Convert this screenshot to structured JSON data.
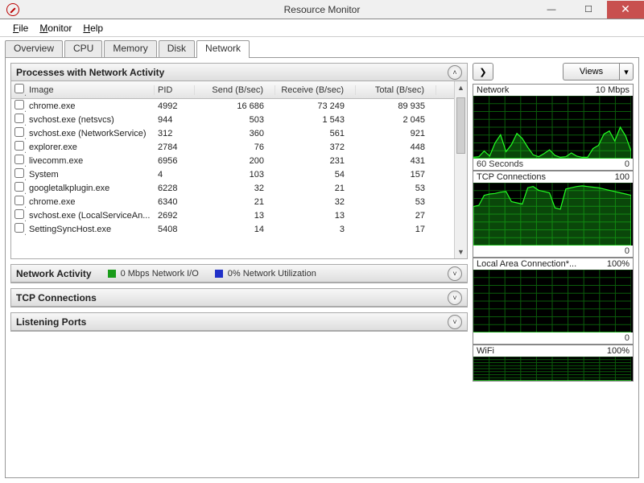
{
  "window": {
    "title": "Resource Monitor"
  },
  "menus": [
    "File",
    "Monitor",
    "Help"
  ],
  "tabs": [
    "Overview",
    "CPU",
    "Memory",
    "Disk",
    "Network"
  ],
  "active_tab": 4,
  "processes_panel": {
    "title": "Processes with Network Activity",
    "columns": [
      "Image",
      "PID",
      "Send (B/sec)",
      "Receive (B/sec)",
      "Total (B/sec)"
    ],
    "rows": [
      {
        "image": "chrome.exe",
        "pid": "4992",
        "send": "16 686",
        "recv": "73 249",
        "total": "89 935"
      },
      {
        "image": "svchost.exe (netsvcs)",
        "pid": "944",
        "send": "503",
        "recv": "1 543",
        "total": "2 045"
      },
      {
        "image": "svchost.exe (NetworkService)",
        "pid": "312",
        "send": "360",
        "recv": "561",
        "total": "921"
      },
      {
        "image": "explorer.exe",
        "pid": "2784",
        "send": "76",
        "recv": "372",
        "total": "448"
      },
      {
        "image": "livecomm.exe",
        "pid": "6956",
        "send": "200",
        "recv": "231",
        "total": "431"
      },
      {
        "image": "System",
        "pid": "4",
        "send": "103",
        "recv": "54",
        "total": "157"
      },
      {
        "image": "googletalkplugin.exe",
        "pid": "6228",
        "send": "32",
        "recv": "21",
        "total": "53"
      },
      {
        "image": "chrome.exe",
        "pid": "6340",
        "send": "21",
        "recv": "32",
        "total": "53"
      },
      {
        "image": "svchost.exe (LocalServiceAn...",
        "pid": "2692",
        "send": "13",
        "recv": "13",
        "total": "27"
      },
      {
        "image": "SettingSyncHost.exe",
        "pid": "5408",
        "send": "14",
        "recv": "3",
        "total": "17"
      }
    ]
  },
  "network_activity_panel": {
    "title": "Network Activity",
    "legend_io_color": "#1a9c1a",
    "legend_io": "0 Mbps Network I/O",
    "legend_util_color": "#2030c8",
    "legend_util": "0% Network Utilization"
  },
  "tcp_panel": {
    "title": "TCP Connections"
  },
  "listening_panel": {
    "title": "Listening Ports"
  },
  "right": {
    "views_label": "Views",
    "graphs": [
      {
        "title": "Network",
        "scale": "10 Mbps",
        "foot_left": "60 Seconds",
        "foot_right": "0",
        "variant": "spiky"
      },
      {
        "title": "TCP Connections",
        "scale": "100",
        "foot_right": "0",
        "variant": "high"
      },
      {
        "title": "Local Area Connection*...",
        "scale": "100%",
        "foot_right": "0",
        "variant": "flat"
      },
      {
        "title": "WiFi",
        "scale": "100%",
        "variant": "flat",
        "short": true
      }
    ]
  },
  "chart_data": [
    {
      "type": "area",
      "title": "Network",
      "ylabel": "Mbps",
      "xlabel": "Seconds",
      "ylim": [
        0,
        10
      ],
      "x_seconds": 60,
      "values": [
        0.2,
        0.3,
        1.2,
        0.4,
        2.5,
        3.8,
        1.1,
        2.2,
        4.0,
        3.2,
        1.8,
        0.6,
        0.3,
        0.8,
        1.4,
        0.5,
        0.2,
        0.3,
        0.9,
        0.4,
        0.2,
        0.2,
        1.6,
        2.1,
        3.9,
        4.4,
        2.8,
        5.0,
        3.6,
        1.2
      ]
    },
    {
      "type": "area",
      "title": "TCP Connections",
      "ylim": [
        0,
        100
      ],
      "x_seconds": 60,
      "values": [
        62,
        64,
        80,
        82,
        83,
        85,
        86,
        70,
        68,
        66,
        92,
        94,
        88,
        86,
        84,
        60,
        58,
        90,
        92,
        94,
        95,
        94,
        93,
        92,
        90,
        88,
        86,
        84,
        82,
        80
      ]
    },
    {
      "type": "area",
      "title": "Local Area Connection*",
      "ylim": [
        0,
        100
      ],
      "unit": "%",
      "x_seconds": 60,
      "values": [
        0,
        0,
        0,
        0,
        0,
        0,
        0,
        0,
        0,
        0,
        0,
        0,
        0,
        0,
        0,
        0,
        0,
        0,
        0,
        0,
        0,
        0,
        0,
        0,
        0,
        0,
        0,
        0,
        0,
        0
      ]
    },
    {
      "type": "area",
      "title": "WiFi",
      "ylim": [
        0,
        100
      ],
      "unit": "%",
      "x_seconds": 60,
      "values": [
        0,
        0,
        0,
        0,
        0,
        0,
        0,
        0,
        0,
        0,
        0,
        0,
        0,
        0,
        0,
        0,
        0,
        0,
        0,
        0,
        0,
        0,
        0,
        0,
        0,
        0,
        0,
        0,
        0,
        0
      ]
    }
  ]
}
